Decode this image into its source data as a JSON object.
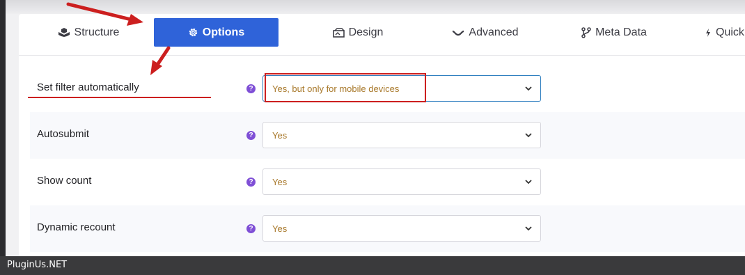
{
  "tabs": [
    {
      "label": "Structure",
      "icon": "cubes-icon"
    },
    {
      "label": "Options",
      "icon": "gear-icon",
      "active": true
    },
    {
      "label": "Design",
      "icon": "design-icon"
    },
    {
      "label": "Advanced",
      "icon": "wave-icon"
    },
    {
      "label": "Meta Data",
      "icon": "branch-icon"
    },
    {
      "label": "Quick",
      "icon": "bolt-icon"
    }
  ],
  "settings": [
    {
      "label": "Set filter automatically",
      "value": "Yes, but only for mobile devices",
      "help": "?"
    },
    {
      "label": "Autosubmit",
      "value": "Yes",
      "help": "?"
    },
    {
      "label": "Show count",
      "value": "Yes",
      "help": "?"
    },
    {
      "label": "Dynamic recount",
      "value": "Yes",
      "help": "?"
    }
  ],
  "footer": {
    "text": "PluginUs.NET"
  },
  "colors": {
    "active_tab": "#2f63d9",
    "select_text": "#a8782a",
    "help_icon": "#7f4fd6",
    "annotation": "#cc1f1f"
  }
}
